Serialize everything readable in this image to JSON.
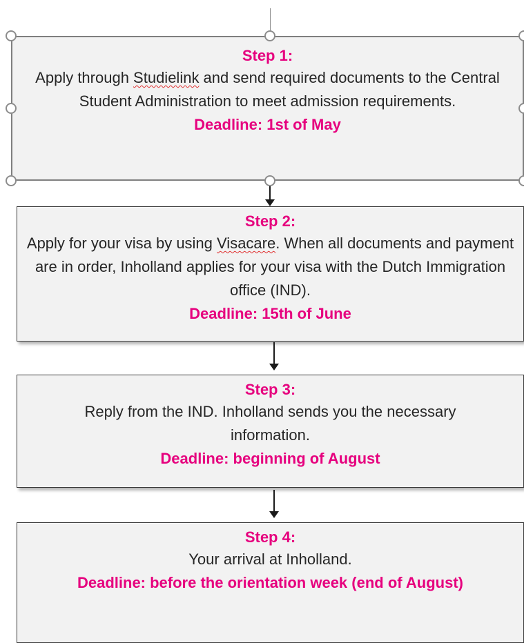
{
  "steps": [
    {
      "title": "Step 1:",
      "desc_before": "Apply through ",
      "desc_link": "Studielink",
      "desc_after": " and send required documents to the Central Student Administration to meet admission requirements.",
      "deadline": "Deadline: 1st of May"
    },
    {
      "title": "Step 2:",
      "desc_before": "Apply for your visa by using ",
      "desc_link": "Visacare",
      "desc_after": ". When all documents and payment are in order, Inholland applies for your visa with the Dutch Immigration office (IND).",
      "deadline": "Deadline: 15th of June"
    },
    {
      "title": "Step 3:",
      "desc": "Reply from the IND. Inholland sends you the necessary information.",
      "deadline": "Deadline: beginning of August"
    },
    {
      "title": "Step 4:",
      "desc": "Your arrival at Inholland.",
      "deadline": "Deadline: before the orientation week (end of August)"
    }
  ],
  "colors": {
    "accent": "#e6007e",
    "box_fill": "#f2f2f2",
    "text": "#262626"
  }
}
